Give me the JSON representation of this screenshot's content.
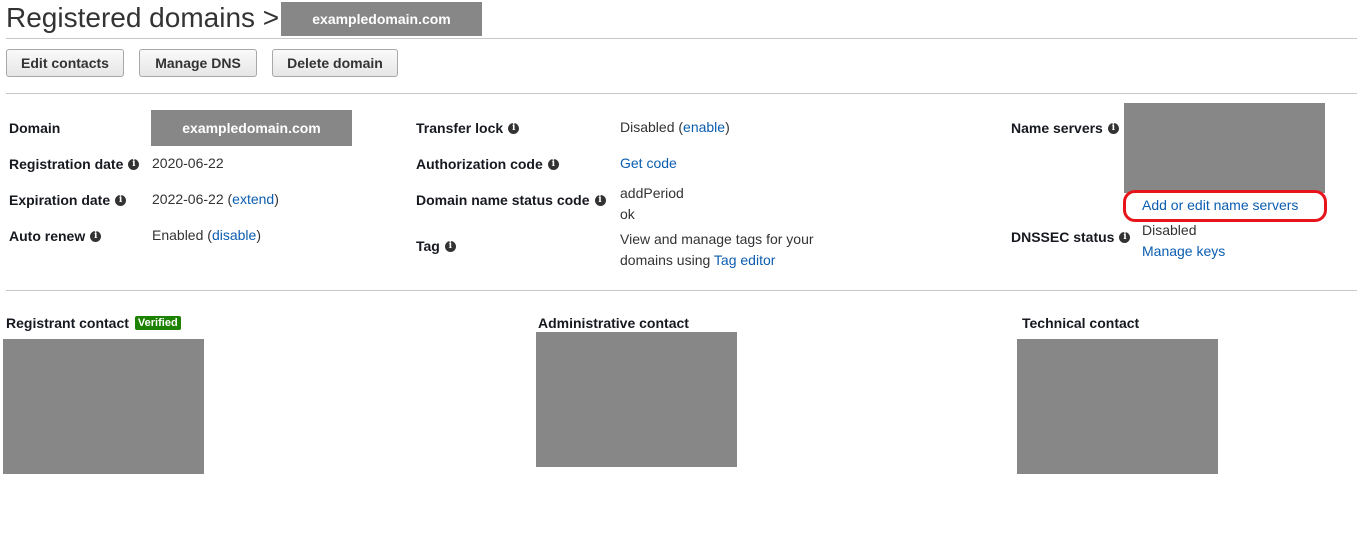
{
  "header": {
    "title": "Registered domains >",
    "domain": "exampledomain.com"
  },
  "toolbar": {
    "edit_contacts": "Edit contacts",
    "manage_dns": "Manage DNS",
    "delete_domain": "Delete domain"
  },
  "details": {
    "domain_label": "Domain",
    "domain_value": "exampledomain.com",
    "registration_label": "Registration date",
    "registration_value": "2020-06-22",
    "expiration_label": "Expiration date",
    "expiration_value": "2022-06-22 (",
    "expiration_link": "extend",
    "expiration_close": ")",
    "autorenew_label": "Auto renew",
    "autorenew_value": "Enabled (",
    "autorenew_link": "disable",
    "autorenew_close": ")",
    "transfer_label": "Transfer lock",
    "transfer_value": "Disabled (",
    "transfer_link": "enable",
    "transfer_close": ")",
    "auth_label": "Authorization code",
    "auth_link": "Get code",
    "status_label": "Domain name status code",
    "status_line1": "addPeriod",
    "status_line2": "ok",
    "tag_label": "Tag",
    "tag_line1": "View and manage tags for your",
    "tag_line2_prefix": "domains using ",
    "tag_link": "Tag editor",
    "ns_label": "Name servers",
    "ns_link": "Add or edit name servers",
    "dnssec_label": "DNSSEC status",
    "dnssec_value": "Disabled",
    "dnssec_link": "Manage keys"
  },
  "contacts": {
    "registrant": "Registrant contact",
    "verified_badge": "Verified",
    "administrative": "Administrative contact",
    "technical": "Technical contact"
  },
  "colors": {
    "link": "#0b5db0",
    "badge": "#1d8102",
    "highlight": "#e8141b",
    "redaction": "#878787"
  }
}
